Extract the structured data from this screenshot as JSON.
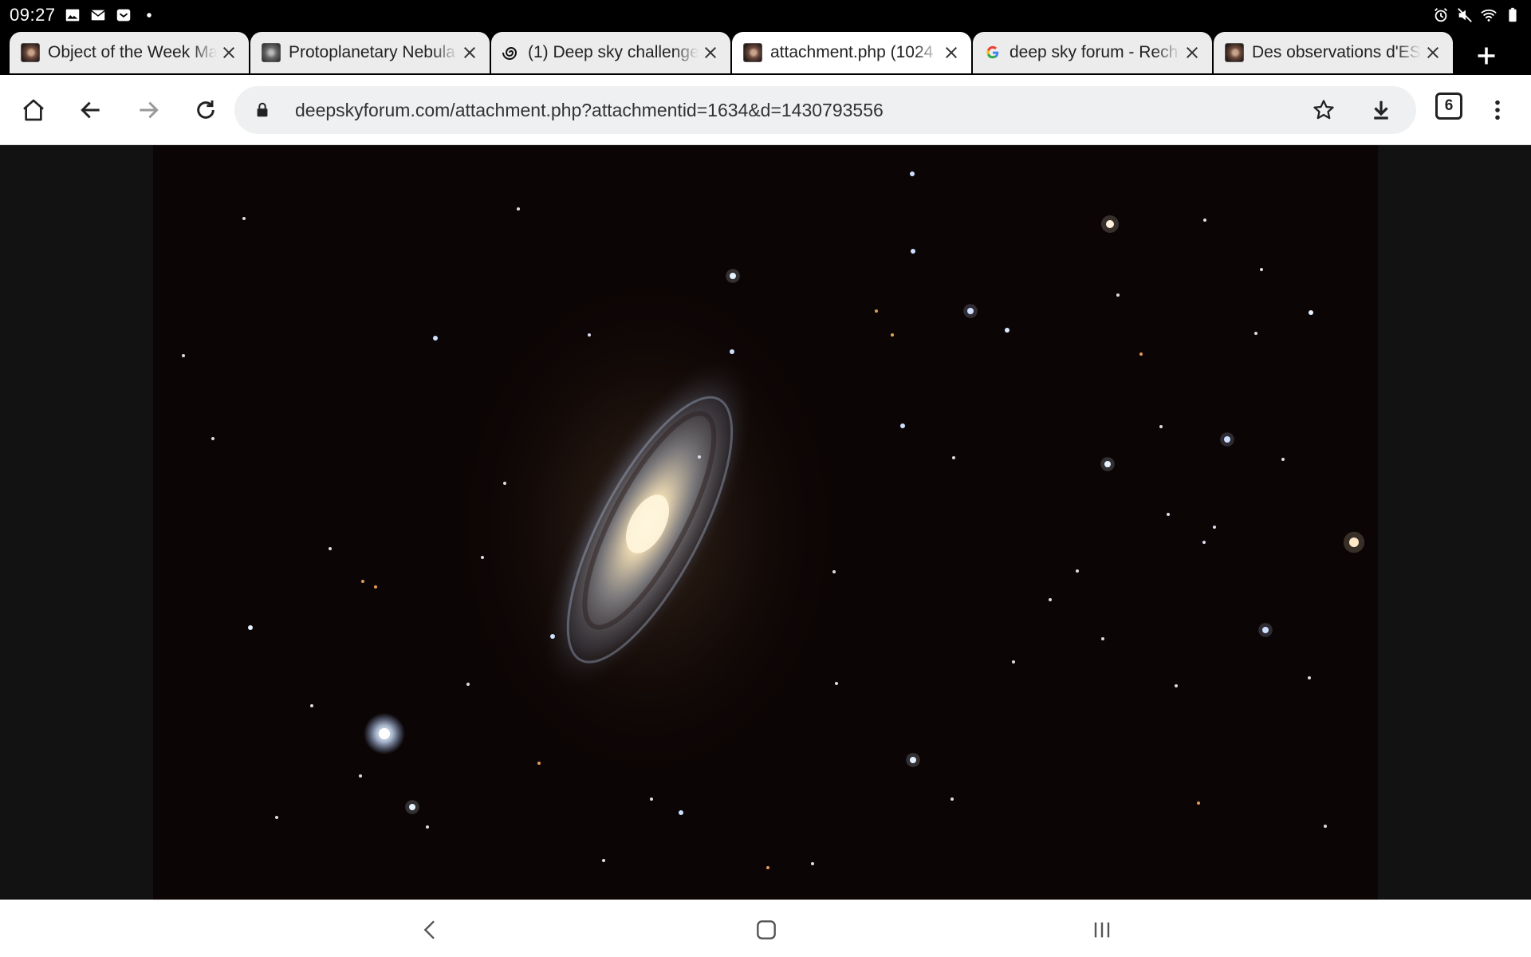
{
  "status_bar": {
    "time": "09:27",
    "left_icons": [
      "image-icon",
      "mail-icon",
      "inbox-icon",
      "dot-icon"
    ],
    "right_icons": [
      "alarm-icon",
      "mute-icon",
      "wifi-icon",
      "battery-icon"
    ]
  },
  "tabs": [
    {
      "title": "Object of the Week Ma",
      "favicon": "image-thumb-icon",
      "active": false
    },
    {
      "title": "Protoplanetary Nebula",
      "favicon": "image-thumb-icon",
      "active": false
    },
    {
      "title": "(1) Deep sky challenge",
      "favicon": "spiral-icon",
      "active": false
    },
    {
      "title": "attachment.php (1024",
      "favicon": "image-thumb-icon",
      "active": true
    },
    {
      "title": "deep sky forum - Rech",
      "favicon": "google-icon",
      "active": false
    },
    {
      "title": "Des observations d'ES",
      "favicon": "image-thumb-icon",
      "active": false
    }
  ],
  "toolbar": {
    "url": "deepskyforum.com/attachment.php?attachmentid=1634&d=1430793556",
    "tab_count": "6"
  },
  "content": {
    "image_description_icon": "galaxy-photo"
  },
  "colors": {
    "tab_active": "#ffffff",
    "tab_inactive": "#ececec",
    "chrome_dark": "#000000",
    "omnibox": "#eef0f2",
    "image_bg": "#0c0505"
  }
}
